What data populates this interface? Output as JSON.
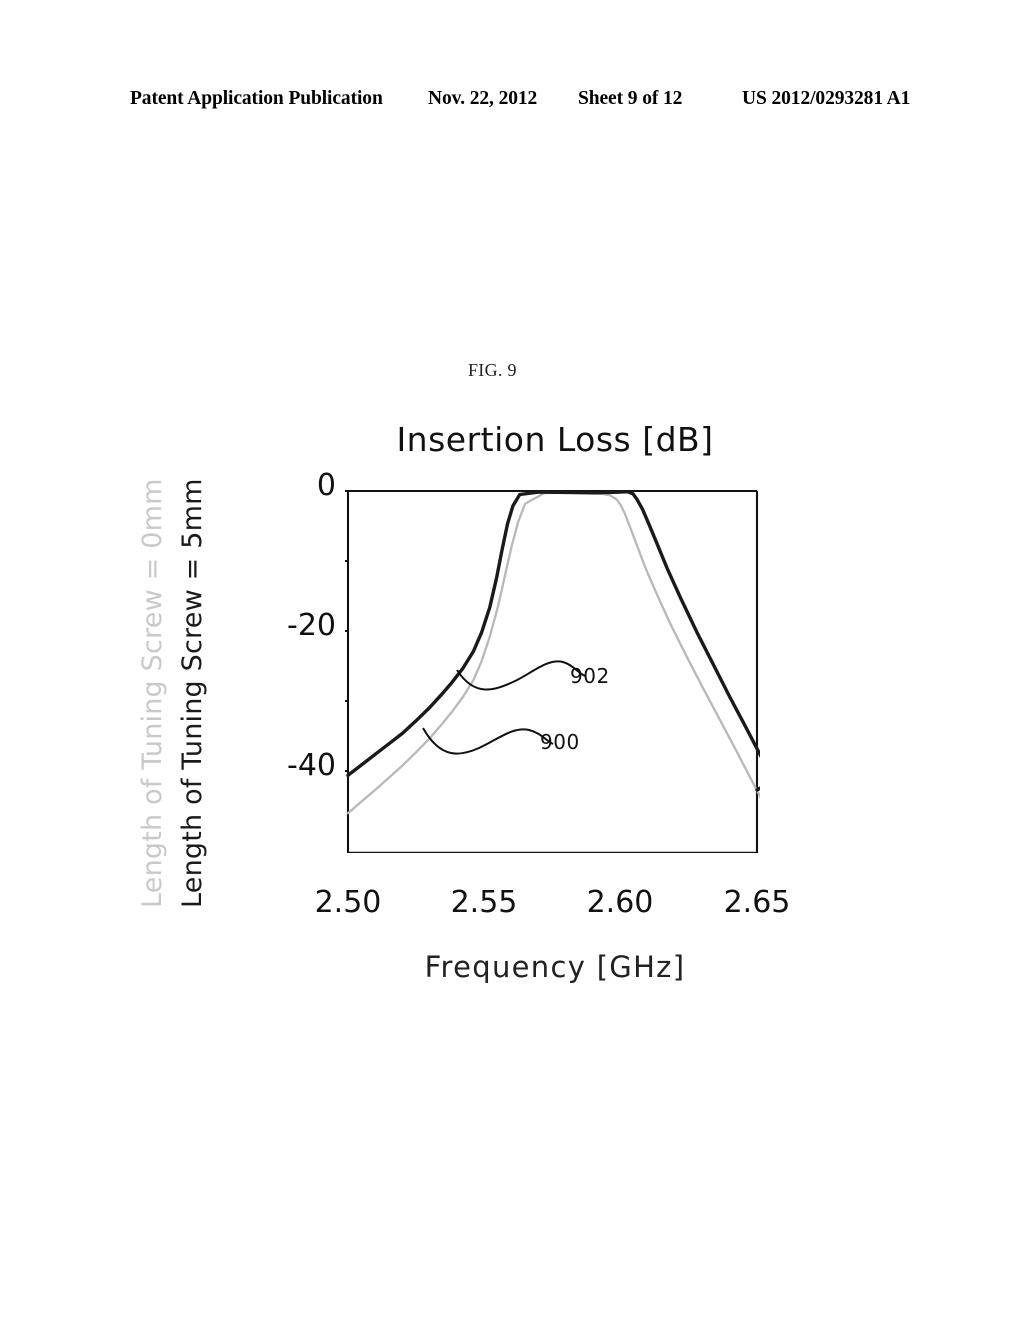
{
  "page_header": {
    "publication": "Patent Application Publication",
    "date": "Nov. 22, 2012",
    "sheet": "Sheet 9 of 12",
    "patent_number": "US 2012/0293281 A1"
  },
  "figure": {
    "label": "FIG. 9"
  },
  "chart_data": {
    "type": "line",
    "title": "Insertion Loss [dB]",
    "xlabel": "Frequency [GHz]",
    "ylabel": "Insertion Loss [dB]",
    "xlim": [
      2.5,
      2.65
    ],
    "ylim": [
      -51.7,
      0
    ],
    "xticks": [
      "2.50",
      "2.55",
      "2.60",
      "2.65"
    ],
    "xtick_values": [
      2.5,
      2.55,
      2.6,
      2.65
    ],
    "x_minor_ticks_per_interval": 5,
    "yticks": [
      "0",
      "-20",
      "-40"
    ],
    "ytick_values": [
      0,
      -20,
      -40
    ],
    "y_minor_tick_values": [
      -10,
      -30
    ],
    "grid": false,
    "legend_position": "y-axis-rotated-annotations",
    "annotations": [
      {
        "name": "callout-902",
        "text": "902",
        "points_to": "series-5mm"
      },
      {
        "name": "callout-900",
        "text": "900",
        "points_to": "series-0mm"
      }
    ],
    "axis_labels_rotated": [
      {
        "name": "y-annotation-0mm",
        "text": "Length of Tuning Screw = 0mm",
        "color": "#c9c9c9"
      },
      {
        "name": "y-annotation-5mm",
        "text": "Length of Tuning Screw = 5mm",
        "color": "#1a1a1a"
      }
    ],
    "series": [
      {
        "name": "Length of Tuning Screw = 5mm",
        "ref": "902",
        "color": "#1a1a1a",
        "x": [
          2.5,
          2.503,
          2.506,
          2.509,
          2.512,
          2.516,
          2.52,
          2.525,
          2.53,
          2.534,
          2.538,
          2.542,
          2.546,
          2.549,
          2.552,
          2.5545,
          2.5565,
          2.5585,
          2.5605,
          2.563,
          2.57,
          2.58,
          2.59,
          2.596,
          2.6,
          2.6025,
          2.6045,
          2.606,
          2.608,
          2.61,
          2.613,
          2.617,
          2.622,
          2.628,
          2.634,
          2.64,
          2.646,
          2.652,
          2.656,
          2.65
        ],
        "y": [
          -40.6,
          -39.7,
          -38.8,
          -37.9,
          -37.0,
          -35.8,
          -34.6,
          -32.8,
          -30.9,
          -29.2,
          -27.4,
          -25.4,
          -22.9,
          -20.2,
          -16.6,
          -12.4,
          -8.4,
          -4.7,
          -2.1,
          -0.5,
          -0.15,
          -0.2,
          -0.25,
          -0.2,
          -0.15,
          -0.1,
          -0.4,
          -1.2,
          -2.6,
          -4.4,
          -7.2,
          -11.0,
          -15.3,
          -20.2,
          -24.8,
          -29.4,
          -33.8,
          -38.3,
          -41.3,
          -42.7
        ]
      },
      {
        "name": "Length of Tuning Screw = 0mm",
        "ref": "900",
        "color": "#b8b8b8",
        "x": [
          2.5,
          2.503,
          2.506,
          2.509,
          2.512,
          2.516,
          2.52,
          2.525,
          2.53,
          2.534,
          2.538,
          2.542,
          2.546,
          2.549,
          2.552,
          2.555,
          2.5575,
          2.56,
          2.5625,
          2.565,
          2.572,
          2.58,
          2.588,
          2.593,
          2.596,
          2.5985,
          2.6,
          2.6015,
          2.6035,
          2.606,
          2.609,
          2.613,
          2.618,
          2.624,
          2.63,
          2.636,
          2.642,
          2.648,
          2.653,
          2.657
        ],
        "y": [
          -46.0,
          -45.0,
          -44.0,
          -43.0,
          -42.0,
          -40.6,
          -39.2,
          -37.3,
          -35.3,
          -33.5,
          -31.6,
          -29.5,
          -27.0,
          -24.3,
          -20.8,
          -16.5,
          -12.2,
          -7.9,
          -4.3,
          -1.8,
          -0.3,
          -0.25,
          -0.3,
          -0.4,
          -0.6,
          -1.2,
          -2.0,
          -3.2,
          -5.2,
          -7.8,
          -10.9,
          -14.5,
          -18.8,
          -23.5,
          -28.0,
          -32.4,
          -36.8,
          -41.3,
          -45.0,
          -48.0
        ]
      }
    ]
  }
}
